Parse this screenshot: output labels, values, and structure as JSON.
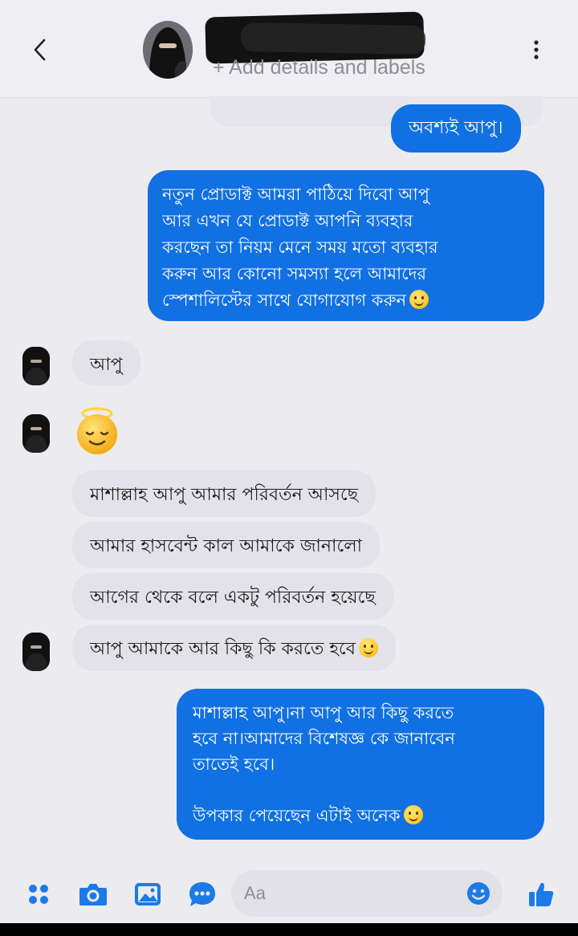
{
  "header": {
    "subtitle": "+ Add details and labels",
    "back_icon": "chevron-left-icon",
    "more_icon": "vertical-dots-icon"
  },
  "messages": {
    "out_1": "অবশ্যই আপু।",
    "out_2_lines": [
      "নতুন প্রোডাক্ট আমরা পাঠিয়ে দিবো আপু",
      "আর এখন যে প্রোডাক্ট আপনি ব্যবহার",
      "করছেন তা  নিয়ম মেনে  সময় মতো ব্যবহার",
      "করুন আর কোনো সমস্যা হলে  আমাদের",
      "স্পেশালিস্টের সাথে যোগাযোগ  করুন"
    ],
    "in_1": "আপু",
    "in_emoji": "smiling-face-with-halo",
    "in_2": "মাশাল্লাহ  আপু আমার পরিবর্তন আসছে",
    "in_3": "আমার হাসবেন্ট  কাল আমাকে জানালো",
    "in_4": "আগের থেকে বলে একটু পরিবর্তন হয়েছে",
    "in_5": "আপু আমাকে আর কিছু কি করতে হবে",
    "out_3_lines": [
      "মাশাল্লাহ আপু।না আপু আর কিছু করতে",
      "হবে না।আমাদের বিশেষজ্ঞ কে জানাবেন",
      "তাতেই হবে।"
    ],
    "out_3_last": "উপকার পেয়েছেন এটাই অনেক"
  },
  "composer": {
    "placeholder": "Aa"
  },
  "colors": {
    "outgoing_bubble": "#1170e2",
    "incoming_bubble": "#e3e2e8",
    "accent_icon": "#1a7be8"
  },
  "icons": [
    "apps-icon",
    "camera-icon",
    "image-icon",
    "chat-bubble-icon",
    "emoji-icon",
    "thumbs-up-icon"
  ]
}
